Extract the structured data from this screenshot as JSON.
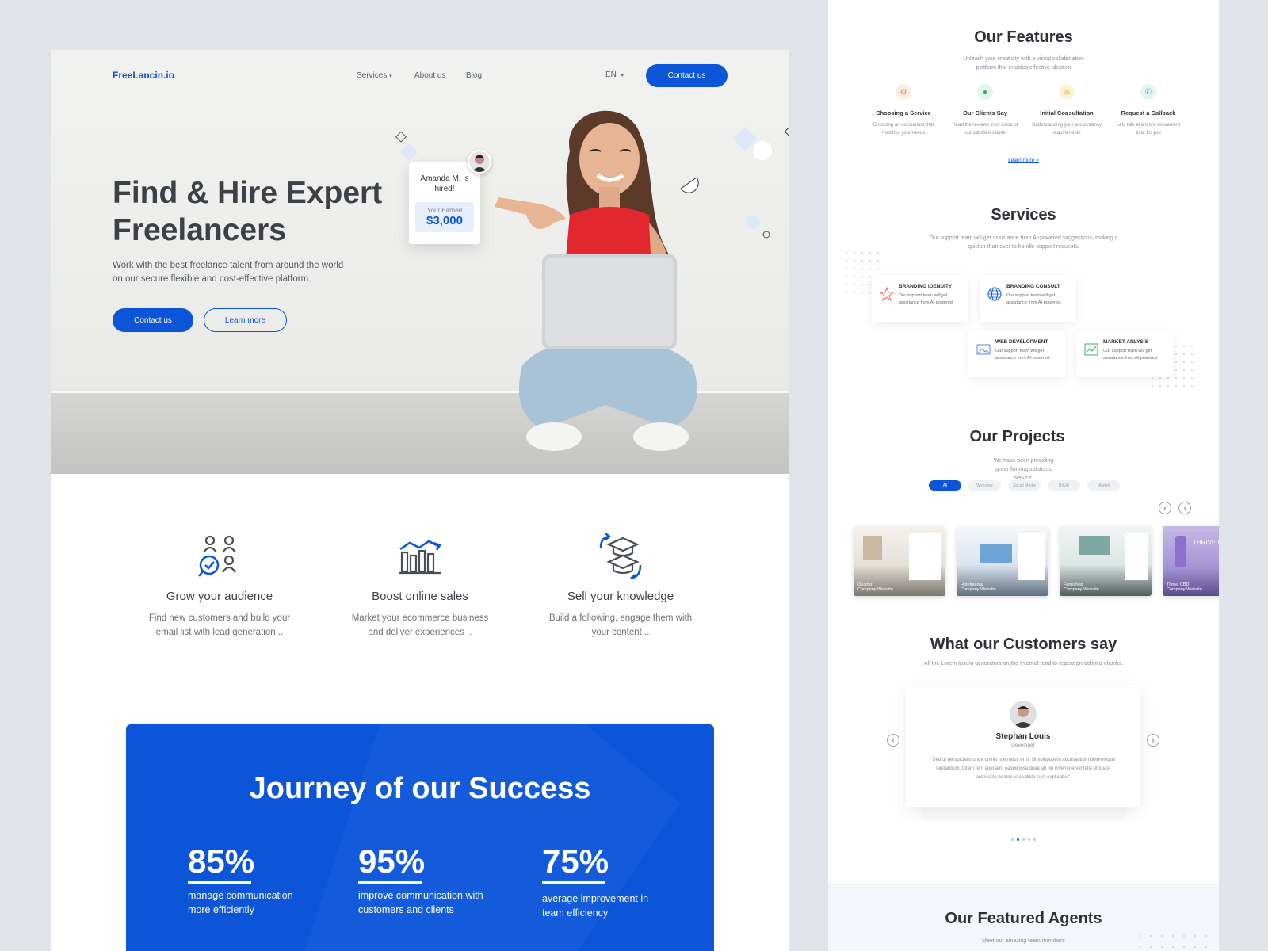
{
  "nav": {
    "logo": "FreeLancin.io",
    "links": [
      "Services",
      "About us",
      "Blog"
    ],
    "lang": "EN",
    "contact": "Contact us"
  },
  "hero": {
    "title": "Find & Hire Expert Freelancers",
    "subtitle": "Work with the best freelance talent from around the world on our secure flexible and cost-effective platform.",
    "primary_btn": "Contact us",
    "secondary_btn": "Learn more",
    "card": {
      "name": "Amanda M. is hired!",
      "earn_label": "Your Earned",
      "earn_value": "$3,000"
    }
  },
  "features": [
    {
      "title": "Grow your audience",
      "desc": "Find new customers and build your email list with lead generation ..",
      "icon": "audience-icon"
    },
    {
      "title": "Boost online sales",
      "desc": "Market your ecommerce business and deliver experiences ..",
      "icon": "sales-chart-icon"
    },
    {
      "title": "Sell your knowledge",
      "desc": "Build a following, engage them with your content ..",
      "icon": "graduation-cap-icon"
    }
  ],
  "success": {
    "title": "Journey of our Success",
    "stats": [
      {
        "value": "85%",
        "label": "manage communication more efficiently"
      },
      {
        "value": "95%",
        "label": "improve communication with customers and clients"
      },
      {
        "value": "75%",
        "label": "average improvement in team efficiency"
      }
    ]
  },
  "right": {
    "features_title": "Our Features",
    "features_sub": "Unleash your creativity with a visual collaboration platform that enables effective ideation",
    "features": [
      {
        "title": "Choosing a Service",
        "desc": "Choosing an accountant that matches your needs",
        "color": "#f57c3b"
      },
      {
        "title": "Our Clients Say",
        "desc": "Read the reviews from some of our satisfied clients",
        "color": "#2fb46a"
      },
      {
        "title": "Initial Consultation",
        "desc": "Understanding your accountancy requirements",
        "color": "#f2b51c"
      },
      {
        "title": "Request a Callback",
        "desc": "Lets talk at a more convenient time for you",
        "color": "#25c3c0"
      }
    ],
    "learn_more": "Learn more  >",
    "services_title": "Services",
    "services_sub": "Our support team will get assistance from AI-powered suggestions, making it quicker than ever to handle support requests.",
    "services": [
      {
        "title": "BRANDING IDENDITY",
        "desc": "Our support team will get assistance from AI-powered."
      },
      {
        "title": "BRANDING CONSULT",
        "desc": "Our support team will get assistance from AI-powered."
      },
      {
        "title": "WEB DEVELOPMENT",
        "desc": "Our support team will get assistance from AI-powered."
      },
      {
        "title": "MARKET ANLYSIS",
        "desc": "Our support team will get assistance from AI-powered."
      }
    ],
    "projects_title": "Our Projects",
    "projects_sub": "We have been providing great flooring solutions service.",
    "chips": [
      "All",
      "Websites",
      "Social Media",
      "UI/UX",
      "Market"
    ],
    "projects": [
      {
        "name": "Quarter",
        "type": "Company Website"
      },
      {
        "name": "Hotelmania",
        "type": "Company Website"
      },
      {
        "name": "Furnishop",
        "type": "Company Website"
      },
      {
        "name": "Thrive CBD",
        "type": "Company Website",
        "brand": "THRIVE CBD OIL"
      }
    ],
    "testimonials_title": "What our Customers say",
    "testimonials_sub": "All the Lorem Ipsum generators on the Internet tend to repeat predefined chunks.",
    "testimonial": {
      "name": "Stephan Louis",
      "role": "Developer",
      "quote": "\"Sed ut perspiciatis unde omnis iste natus error sit voluptatem accusantium doloremque laudantium, totam rem aperiam, eaque ipsa quae ab illo inventore veritatis et quasi architecto beatae vitae dicta sunt explicabo.\""
    },
    "agents_title": "Our Featured Agents",
    "agents_sub": "Meet our amazing team members"
  },
  "colors": {
    "brand": "#0c55d8",
    "text": "#3c3f45",
    "muted": "#6b7079"
  }
}
